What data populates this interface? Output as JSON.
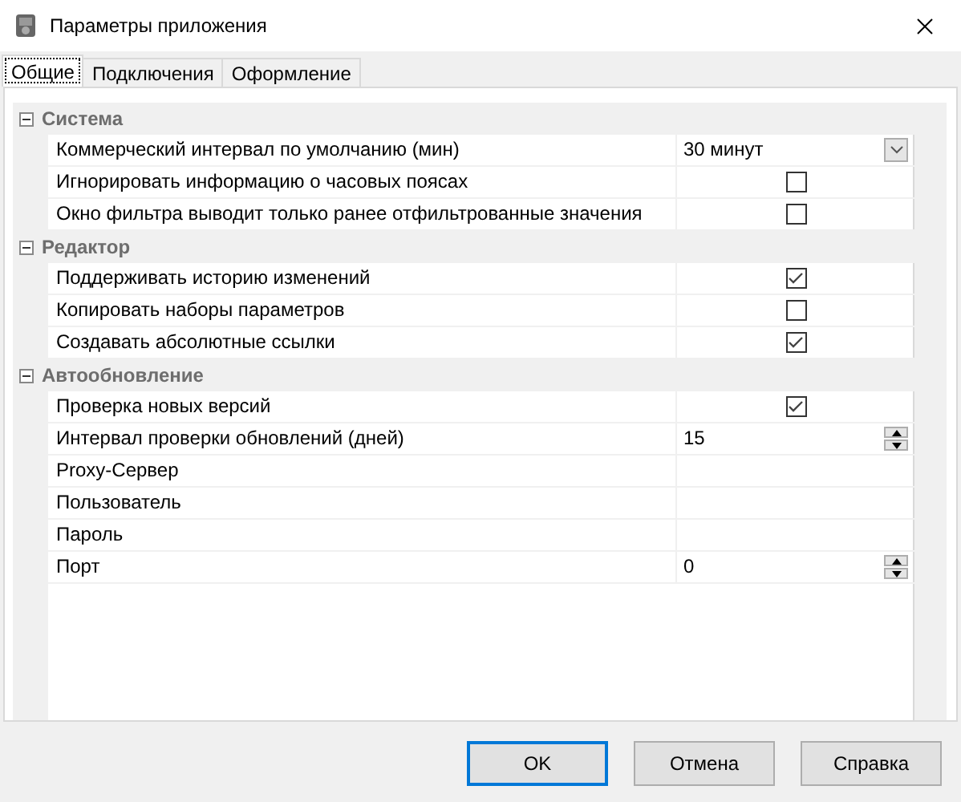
{
  "window": {
    "title": "Параметры приложения"
  },
  "tabs": [
    {
      "label": "Общие",
      "selected": true
    },
    {
      "label": "Подключения",
      "selected": false
    },
    {
      "label": "Оформление",
      "selected": false
    }
  ],
  "categories": [
    {
      "name": "Система",
      "expanded": true,
      "properties": [
        {
          "kind": "combo",
          "label": "Коммерческий интервал по умолчанию (мин)",
          "value": "30 минут"
        },
        {
          "kind": "checkbox",
          "label": "Игнорировать информацию о часовых поясах",
          "checked": false
        },
        {
          "kind": "checkbox",
          "label": "Окно фильтра выводит только ранее отфильтрованные значения",
          "checked": false
        }
      ]
    },
    {
      "name": "Редактор",
      "expanded": true,
      "properties": [
        {
          "kind": "checkbox",
          "label": "Поддерживать историю изменений",
          "checked": true
        },
        {
          "kind": "checkbox",
          "label": "Копировать наборы параметров",
          "checked": false
        },
        {
          "kind": "checkbox",
          "label": "Создавать абсолютные ссылки",
          "checked": true
        }
      ]
    },
    {
      "name": "Автообновление",
      "expanded": true,
      "properties": [
        {
          "kind": "checkbox",
          "label": "Проверка новых версий",
          "checked": true
        },
        {
          "kind": "spin",
          "label": "Интервал проверки обновлений (дней)",
          "value": "15"
        },
        {
          "kind": "text",
          "label": "Proxy-Сервер"
        },
        {
          "kind": "text",
          "label": "Пользователь"
        },
        {
          "kind": "text",
          "label": "Пароль"
        },
        {
          "kind": "spin",
          "label": "Порт",
          "value": "0"
        }
      ]
    }
  ],
  "buttons": [
    {
      "label": "OK",
      "default": true
    },
    {
      "label": "Отмена",
      "default": false
    },
    {
      "label": "Справка",
      "default": false
    }
  ]
}
